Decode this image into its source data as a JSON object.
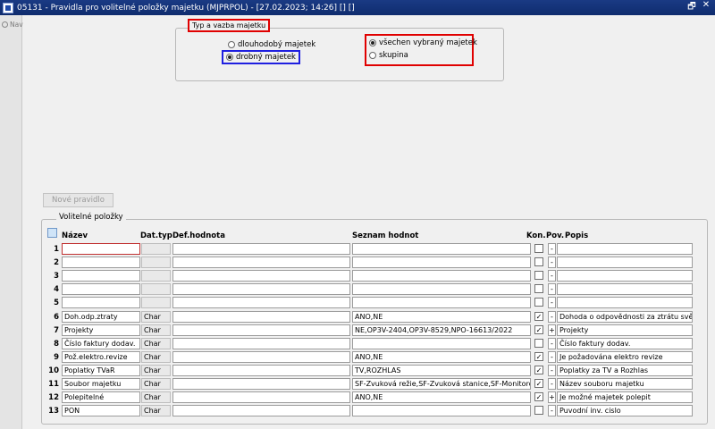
{
  "window": {
    "title": "05131 - Pravidla pro volitelné položky majetku (MJPRPOL) - [27.02.2023; 14:26] [] []",
    "restore_symbol": "🗗",
    "close_symbol": "✕"
  },
  "nav": {
    "label": "Nav"
  },
  "type_group": {
    "legend": "Typ a vazba majetku",
    "options_left": [
      {
        "label": "dlouhodobý majetek",
        "selected": false
      },
      {
        "label": "drobný majetek",
        "selected": true
      }
    ],
    "options_right": [
      {
        "label": "všechen vybraný majetek",
        "selected": true
      },
      {
        "label": "skupina",
        "selected": false
      }
    ]
  },
  "new_rule_button": "Nové pravidlo",
  "grid": {
    "title": "Volitelné položky",
    "headers": {
      "name": "Název",
      "dtype": "Dat.typ",
      "default": "Def.hodnota",
      "values": "Seznam hodnot",
      "kon": "Kon.",
      "pov": "Pov.",
      "desc": "Popis"
    },
    "rows": [
      {
        "num": "1",
        "name": "",
        "dtype": "",
        "default": "",
        "values": "",
        "kon": false,
        "pov": "-",
        "desc": ""
      },
      {
        "num": "2",
        "name": "",
        "dtype": "",
        "default": "",
        "values": "",
        "kon": false,
        "pov": "-",
        "desc": ""
      },
      {
        "num": "3",
        "name": "",
        "dtype": "",
        "default": "",
        "values": "",
        "kon": false,
        "pov": "-",
        "desc": ""
      },
      {
        "num": "4",
        "name": "",
        "dtype": "",
        "default": "",
        "values": "",
        "kon": false,
        "pov": "-",
        "desc": ""
      },
      {
        "num": "5",
        "name": "",
        "dtype": "",
        "default": "",
        "values": "",
        "kon": false,
        "pov": "-",
        "desc": ""
      },
      {
        "num": "6",
        "name": "Doh.odp.ztraty",
        "dtype": "Char",
        "default": "",
        "values": "ANO,NE",
        "kon": true,
        "pov": "-",
        "desc": "Dohoda o odpovědnosti za ztrátu svěře"
      },
      {
        "num": "7",
        "name": "Projekty",
        "dtype": "Char",
        "default": "",
        "values": "NE,OP3V-2404,OP3V-8529,NPO-16613/2022",
        "kon": true,
        "pov": "+",
        "desc": "Projekty"
      },
      {
        "num": "8",
        "name": "Číslo faktury dodav.",
        "dtype": "Char",
        "default": "",
        "values": "",
        "kon": false,
        "pov": "-",
        "desc": "Číslo faktury dodav."
      },
      {
        "num": "9",
        "name": "Pož.elektro.revize",
        "dtype": "Char",
        "default": "",
        "values": "ANO,NE",
        "kon": true,
        "pov": "-",
        "desc": "Je požadována elektro revize"
      },
      {
        "num": "10",
        "name": "Poplatky TVaR",
        "dtype": "Char",
        "default": "",
        "values": "TV,ROZHLAS",
        "kon": true,
        "pov": "-",
        "desc": "Poplatky za TV a Rozhlas"
      },
      {
        "num": "11",
        "name": "Soubor majetku",
        "dtype": "Char",
        "default": "",
        "values": "SF-Zvuková režie,SF-Zvuková stanice,SF-Monitorov",
        "kon": true,
        "pov": "-",
        "desc": "Název souboru majetku"
      },
      {
        "num": "12",
        "name": "Polepitelné",
        "dtype": "Char",
        "default": "",
        "values": "ANO,NE",
        "kon": true,
        "pov": "+",
        "desc": "Je možné majetek polepit"
      },
      {
        "num": "13",
        "name": "PON",
        "dtype": "Char",
        "default": "",
        "values": "",
        "kon": false,
        "pov": "-",
        "desc": "Puvodní inv. cislo"
      }
    ]
  }
}
